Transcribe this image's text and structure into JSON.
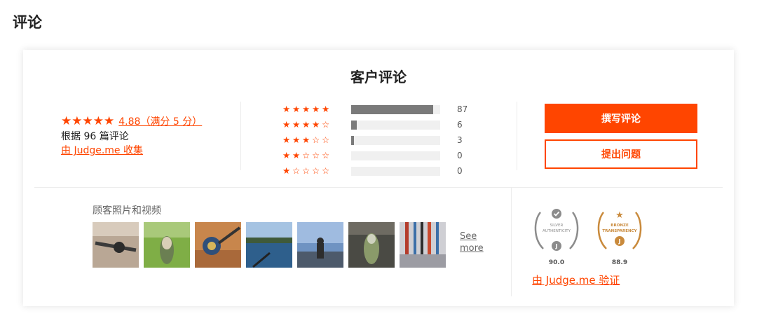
{
  "page_title": "评论",
  "card_title": "客户评论",
  "summary": {
    "average_text": "4.88（满分 5 分）",
    "review_count_text": "根据 96 篇评论",
    "collected_by_text": "由 Judge.me 收集"
  },
  "histogram": [
    {
      "stars": 5,
      "count": "87",
      "fraction": 0.92
    },
    {
      "stars": 4,
      "count": "6",
      "fraction": 0.06
    },
    {
      "stars": 3,
      "count": "3",
      "fraction": 0.03
    },
    {
      "stars": 2,
      "count": "0",
      "fraction": 0.0
    },
    {
      "stars": 1,
      "count": "0",
      "fraction": 0.0
    }
  ],
  "buttons": {
    "write_review": "撰写评论",
    "ask_question": "提出问题"
  },
  "media": {
    "title": "顾客照片和视频",
    "see_more_line1": "See",
    "see_more_line2": "more"
  },
  "badges": {
    "silver_label_1": "SILVER",
    "silver_label_2": "AUTHENTICITY",
    "silver_score": "90.0",
    "bronze_label_1": "BRONZE",
    "bronze_label_2": "TRANSPARENCY",
    "bronze_score": "88.9",
    "verify_text": "由 Judge.me 验证"
  },
  "colors": {
    "accent": "#ff4500",
    "bar_fill": "#7a7a7a",
    "bar_track": "#f0f0f0",
    "silver": "#8c8c8c",
    "bronze": "#c98a3c"
  }
}
